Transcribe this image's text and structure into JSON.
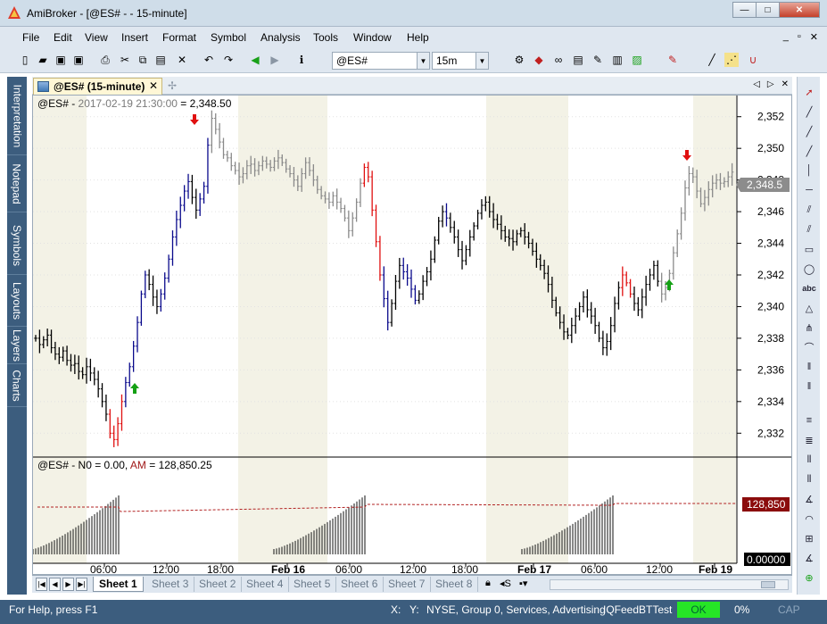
{
  "window": {
    "title": "AmiBroker - [@ES# - - 15-minute]",
    "minimize": "—",
    "restore": "□",
    "close": "✕"
  },
  "menu": [
    "File",
    "Edit",
    "View",
    "Insert",
    "Format",
    "Symbol",
    "Analysis",
    "Tools",
    "Window",
    "Help"
  ],
  "toolbar": {
    "symbol": "@ES#",
    "interval": "15m"
  },
  "sidebar_left": [
    "Interpretation",
    "Notepad",
    "Symbols",
    "Layouts",
    "Layers",
    "Charts"
  ],
  "doc_tab": {
    "label": "@ES# (15-minute)",
    "close": "✕"
  },
  "price_pane": {
    "legend_symbol": "@ES# - ",
    "legend_date": "2017-02-19 21:30:00",
    "legend_sep": " = ",
    "legend_value": "2,348.50",
    "last_price_label": "2,348.5",
    "y_ticks": [
      "2,352",
      "2,350",
      "2,348",
      "2,346",
      "2,344",
      "2,342",
      "2,340",
      "2,338",
      "2,336",
      "2,334",
      "2,332"
    ]
  },
  "indicator_pane": {
    "legend_prefix": "@ES# - N0 = 0.00, ",
    "legend_am": "AM",
    "legend_am_value": " = 128,850.25",
    "value_badge": "128,850",
    "zero_badge": "0.00000"
  },
  "time_axis": [
    "06:00",
    "12:00",
    "18:00",
    "Feb 16",
    "06:00",
    "12:00",
    "18:00",
    "Feb 17",
    "06:00",
    "12:00",
    "Feb 19"
  ],
  "sheets": [
    "Sheet 1",
    "Sheet 3",
    "Sheet 2",
    "Sheet 4",
    "Sheet 5",
    "Sheet 6",
    "Sheet 7",
    "Sheet 8"
  ],
  "status": {
    "help": "For Help, press F1",
    "x": "X:",
    "y": "Y:",
    "market": "NYSE, Group 0, Services, Advertising",
    "db": "IQFeedBTTest",
    "ok": "OK",
    "percent": "0%",
    "cap": "CAP"
  },
  "colors": {
    "up_blue": "#0a0a8c",
    "down_red": "#e01010",
    "neutral": "#000000",
    "future_gray": "#8a8a8a",
    "session_shade": "#f3f2e6",
    "buy_arrow": "#14a014",
    "sell_arrow": "#e01010",
    "am_line": "#b22222",
    "status_bg": "#3c5d7e"
  },
  "chart_data": {
    "type": "bar",
    "y_range": [
      2331,
      2353
    ],
    "ohlc_close": [
      2338.0,
      2337.6,
      2337.9,
      2338.2,
      2337.4,
      2337.0,
      2336.8,
      2337.2,
      2336.6,
      2336.3,
      2336.4,
      2335.9,
      2335.7,
      2336.2,
      2335.8,
      2335.4,
      2334.8,
      2334.0,
      2333.2,
      2332.0,
      2331.6,
      2332.6,
      2334.0,
      2335.2,
      2336.2,
      2337.5,
      2339.0,
      2340.8,
      2342.0,
      2341.4,
      2340.6,
      2340.0,
      2340.8,
      2341.8,
      2343.0,
      2344.4,
      2345.5,
      2346.4,
      2347.3,
      2347.9,
      2346.9,
      2346.1,
      2346.8,
      2347.6,
      2350.2,
      2351.9,
      2351.2,
      2350.4,
      2349.6,
      2349.4,
      2348.9,
      2348.6,
      2348.2,
      2348.4,
      2348.9,
      2349.0,
      2348.6,
      2348.9,
      2349.2,
      2349.0,
      2348.8,
      2349.2,
      2349.4,
      2349.1,
      2348.7,
      2348.4,
      2348.0,
      2347.6,
      2348.4,
      2349.1,
      2348.6,
      2348.0,
      2347.4,
      2347.0,
      2346.8,
      2346.6,
      2347.0,
      2346.6,
      2346.2,
      2345.6,
      2344.8,
      2345.6,
      2346.6,
      2347.8,
      2348.8,
      2348.2,
      2346.1,
      2344.1,
      2342.0,
      2340.5,
      2339.0,
      2340.2,
      2341.6,
      2342.6,
      2342.2,
      2341.8,
      2341.1,
      2340.4,
      2340.8,
      2341.6,
      2342.2,
      2343.0,
      2344.2,
      2345.4,
      2346.0,
      2345.6,
      2345.0,
      2344.4,
      2343.6,
      2342.9,
      2343.6,
      2344.4,
      2345.1,
      2345.9,
      2346.4,
      2346.6,
      2346.0,
      2345.5,
      2345.2,
      2344.8,
      2344.4,
      2344.3,
      2344.1,
      2344.6,
      2344.8,
      2344.4,
      2344.0,
      2343.5,
      2343.0,
      2342.6,
      2342.1,
      2341.4,
      2340.4,
      2339.6,
      2339.0,
      2338.4,
      2338.2,
      2338.8,
      2339.4,
      2340.0,
      2340.6,
      2339.8,
      2339.4,
      2338.8,
      2338.0,
      2337.4,
      2337.8,
      2338.8,
      2340.2,
      2341.2,
      2342.0,
      2341.5,
      2340.8,
      2340.2,
      2339.8,
      2340.6,
      2341.4,
      2342.0,
      2342.6,
      2341.6,
      2340.8,
      2341.2,
      2342.1,
      2343.4,
      2344.6,
      2345.9,
      2347.5,
      2348.4,
      2348.2,
      2347.3,
      2346.5,
      2346.9,
      2347.4,
      2347.8,
      2348.0,
      2347.8,
      2347.9,
      2348.2,
      2348.5
    ],
    "am_session_peaks": [
      128850.25,
      128850.25,
      128850.25
    ]
  }
}
